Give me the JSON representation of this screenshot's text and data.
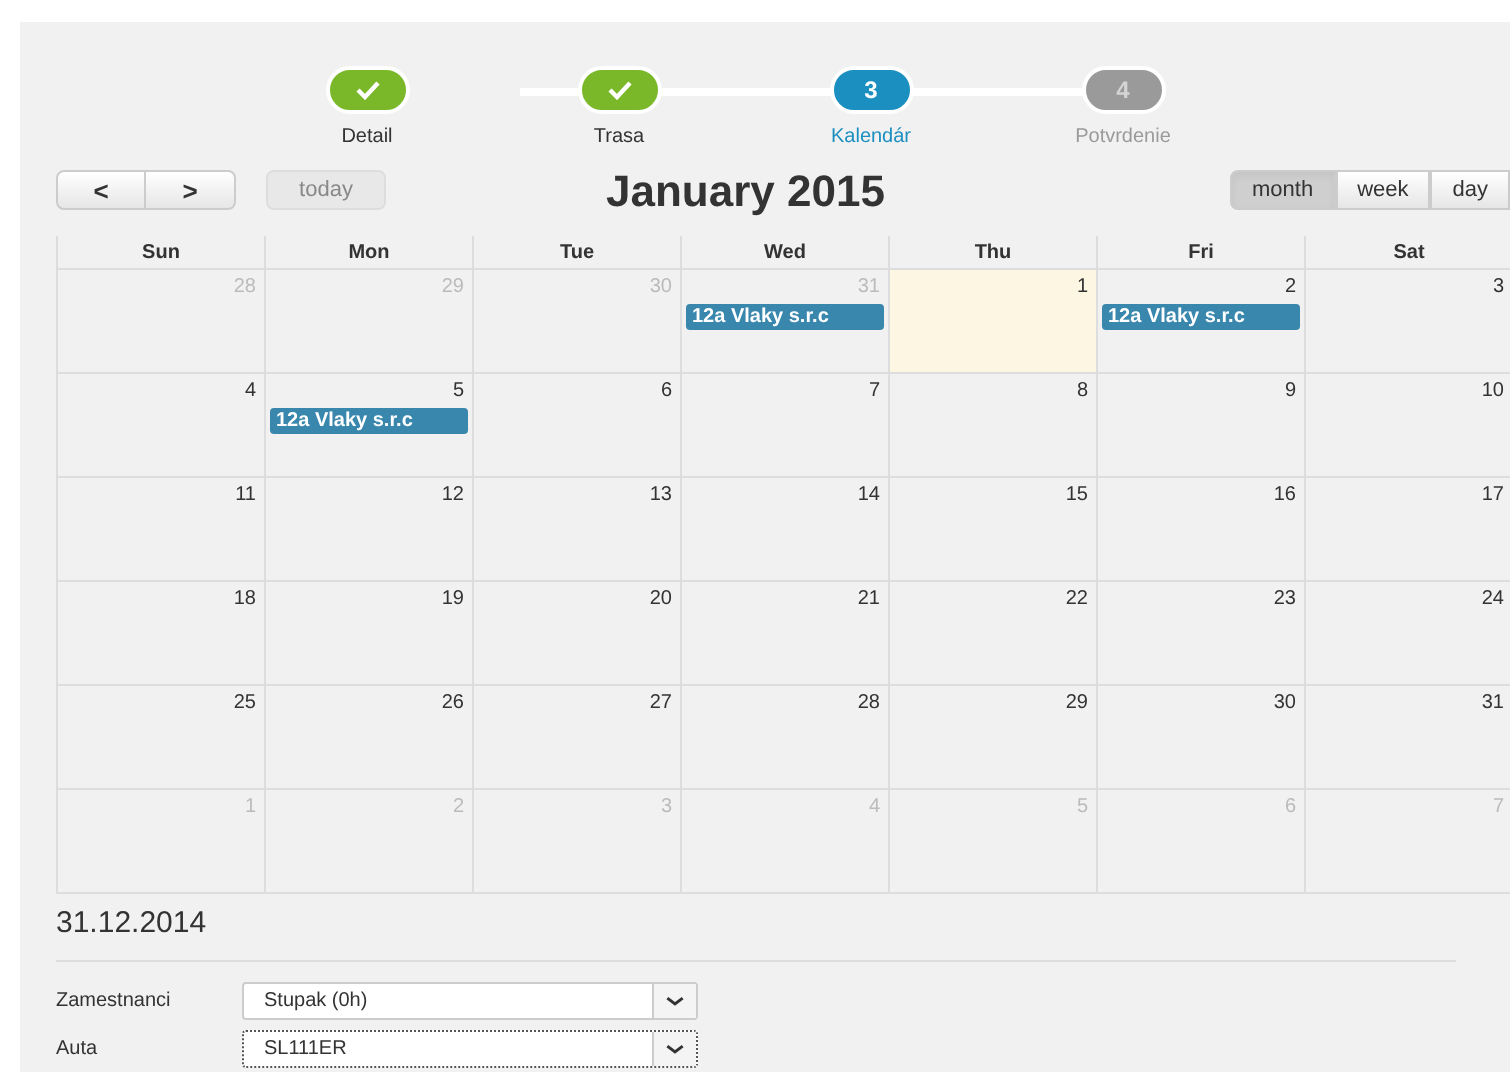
{
  "steps": [
    {
      "label": "Detail",
      "completed": true,
      "selected": false
    },
    {
      "label": "Trasa",
      "completed": true,
      "selected": false
    },
    {
      "label": "Kalendár",
      "completed": false,
      "selected": true,
      "number": "3"
    },
    {
      "label": "Potvrdenie",
      "completed": false,
      "selected": false,
      "number": "4"
    }
  ],
  "toolbar": {
    "prev": "<",
    "next": ">",
    "today": {
      "label": "today",
      "disabled": true
    },
    "title": "January 2015",
    "views": [
      {
        "label": "month",
        "selected": true
      },
      {
        "label": "week",
        "selected": false
      },
      {
        "label": "day",
        "selected": false
      }
    ]
  },
  "calendar": {
    "weekdays": [
      "Sun",
      "Mon",
      "Tue",
      "Wed",
      "Thu",
      "Fri",
      "Sat"
    ],
    "weeks": [
      [
        {
          "day": "28",
          "other_month": true,
          "today": false
        },
        {
          "day": "29",
          "other_month": true,
          "today": false
        },
        {
          "day": "30",
          "other_month": true,
          "today": false
        },
        {
          "day": "31",
          "other_month": true,
          "today": false,
          "events": [
            "12a Vlaky s.r.c"
          ]
        },
        {
          "day": "1",
          "other_month": false,
          "today": true
        },
        {
          "day": "2",
          "other_month": false,
          "today": false,
          "events": [
            "12a Vlaky s.r.c"
          ]
        },
        {
          "day": "3",
          "other_month": false,
          "today": false
        }
      ],
      [
        {
          "day": "4",
          "other_month": false,
          "today": false
        },
        {
          "day": "5",
          "other_month": false,
          "today": false,
          "events": [
            "12a Vlaky s.r.c"
          ]
        },
        {
          "day": "6",
          "other_month": false,
          "today": false
        },
        {
          "day": "7",
          "other_month": false,
          "today": false
        },
        {
          "day": "8",
          "other_month": false,
          "today": false
        },
        {
          "day": "9",
          "other_month": false,
          "today": false
        },
        {
          "day": "10",
          "other_month": false,
          "today": false
        }
      ],
      [
        {
          "day": "11",
          "other_month": false,
          "today": false
        },
        {
          "day": "12",
          "other_month": false,
          "today": false
        },
        {
          "day": "13",
          "other_month": false,
          "today": false
        },
        {
          "day": "14",
          "other_month": false,
          "today": false
        },
        {
          "day": "15",
          "other_month": false,
          "today": false
        },
        {
          "day": "16",
          "other_month": false,
          "today": false
        },
        {
          "day": "17",
          "other_month": false,
          "today": false
        }
      ],
      [
        {
          "day": "18",
          "other_month": false,
          "today": false
        },
        {
          "day": "19",
          "other_month": false,
          "today": false
        },
        {
          "day": "20",
          "other_month": false,
          "today": false
        },
        {
          "day": "21",
          "other_month": false,
          "today": false
        },
        {
          "day": "22",
          "other_month": false,
          "today": false
        },
        {
          "day": "23",
          "other_month": false,
          "today": false
        },
        {
          "day": "24",
          "other_month": false,
          "today": false
        }
      ],
      [
        {
          "day": "25",
          "other_month": false,
          "today": false
        },
        {
          "day": "26",
          "other_month": false,
          "today": false
        },
        {
          "day": "27",
          "other_month": false,
          "today": false
        },
        {
          "day": "28",
          "other_month": false,
          "today": false
        },
        {
          "day": "29",
          "other_month": false,
          "today": false
        },
        {
          "day": "30",
          "other_month": false,
          "today": false
        },
        {
          "day": "31",
          "other_month": false,
          "today": false
        }
      ],
      [
        {
          "day": "1",
          "other_month": true,
          "today": false
        },
        {
          "day": "2",
          "other_month": true,
          "today": false
        },
        {
          "day": "3",
          "other_month": true,
          "today": false
        },
        {
          "day": "4",
          "other_month": true,
          "today": false
        },
        {
          "day": "5",
          "other_month": true,
          "today": false
        },
        {
          "day": "6",
          "other_month": true,
          "today": false
        },
        {
          "day": "7",
          "other_month": true,
          "today": false
        }
      ]
    ]
  },
  "selected_date": "31.12.2014",
  "form": [
    {
      "label": "Zamestnanci",
      "value": "Stupak (0h)",
      "focused": false
    },
    {
      "label": "Auta",
      "value": "SL111ER",
      "focused": true
    }
  ]
}
